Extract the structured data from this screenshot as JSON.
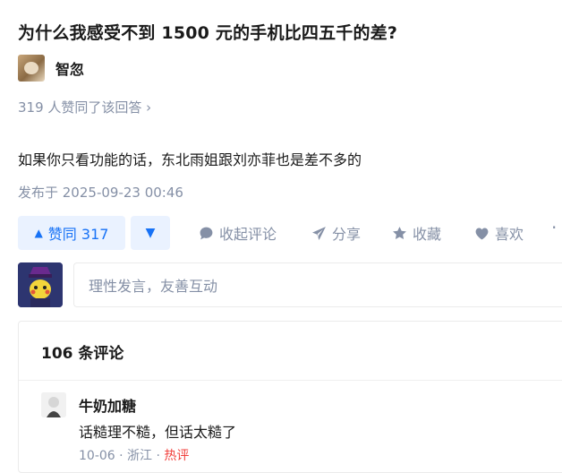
{
  "question": {
    "title": "为什么我感受不到 1500 元的手机比四五千的差?"
  },
  "author": {
    "name": "智忽"
  },
  "answer": {
    "upvote_summary": "319 人赞同了该回答 ›",
    "text": "如果你只看功能的话，东北雨姐跟刘亦菲也是差不多的",
    "published": "发布于 2025-09-23 00:46"
  },
  "actions": {
    "upvote_label": "赞同 317",
    "collapse_comments": "收起评论",
    "share": "分享",
    "favorite": "收藏",
    "like": "喜欢"
  },
  "comment_box": {
    "placeholder": "理性发言，友善互动"
  },
  "comments": {
    "count_label": "106 条评论",
    "items": [
      {
        "user": "牛奶加糖",
        "text": "话糙理不糙，但话太糙了",
        "date": "10-06",
        "location": "浙江",
        "tag": "热评"
      }
    ]
  },
  "colors": {
    "accent": "#1772f6",
    "muted": "#8590a6",
    "hot": "#f1403c",
    "vote_bg": "#eaf2ff"
  },
  "icons": [
    "caret-up-icon",
    "caret-down-icon",
    "comment-icon",
    "share-icon",
    "star-icon",
    "heart-icon",
    "more-icon"
  ]
}
